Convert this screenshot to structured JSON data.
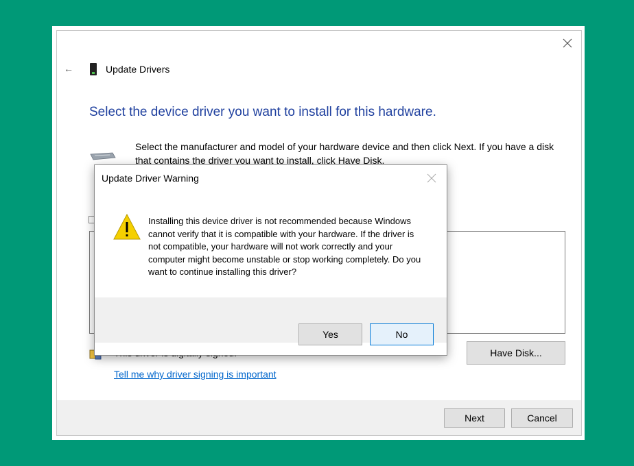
{
  "window": {
    "title": "Update Drivers",
    "back_icon": "back-arrow-icon",
    "close_icon": "close-icon",
    "heading": "Select the device driver you want to install for this hardware.",
    "instructions": "Select the manufacturer and model of your hardware device and then click Next. If you have a disk that contains the driver you want to install, click Have Disk.",
    "signed_text": "This driver is digitally signed.",
    "have_disk_label": "Have Disk...",
    "link_text": "Tell me why driver signing is important",
    "next_label": "Next",
    "cancel_label": "Cancel"
  },
  "dialog": {
    "title": "Update Driver Warning",
    "message": "Installing this device driver is not recommended because Windows cannot verify that it is compatible with your hardware.  If the driver is not compatible, your hardware will not work correctly and your computer might become unstable or stop working completely.  Do you want to continue installing this driver?",
    "yes_label": "Yes",
    "no_label": "No",
    "icon": "warning-icon"
  },
  "colors": {
    "background": "#009977",
    "heading": "#1e3f9e",
    "link": "#0066cc",
    "warning": "#f5d000",
    "focus_border": "#0078d7"
  }
}
